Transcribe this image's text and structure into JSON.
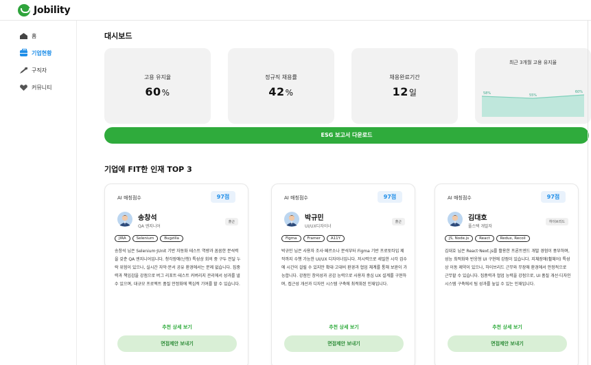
{
  "app": {
    "name": "Jobility",
    "brand_color": "#2fab3c",
    "accent_color": "#1f8ee8"
  },
  "sidebar": {
    "items": [
      {
        "label": "홈",
        "icon": "home-icon",
        "active": false
      },
      {
        "label": "기업현황",
        "icon": "briefcase-icon",
        "active": true
      },
      {
        "label": "구직자",
        "icon": "tool-icon",
        "active": false
      },
      {
        "label": "커뮤니티",
        "icon": "heart-icon",
        "active": false
      }
    ]
  },
  "dashboard": {
    "title": "대시보드",
    "stats": [
      {
        "label": "고용 유지율",
        "value": "60",
        "unit": "%"
      },
      {
        "label": "정규직 채용률",
        "value": "42",
        "unit": "%"
      },
      {
        "label": "채용완료기간",
        "value": "12",
        "unit": "일"
      }
    ],
    "chart_data": {
      "type": "area",
      "title": "최근 3개월 고용 유지율",
      "x": [
        "",
        "",
        ""
      ],
      "values": [
        58,
        55,
        60
      ],
      "data_labels": [
        "58%",
        "55%",
        "60%"
      ],
      "ylim": [
        0,
        100
      ],
      "fill_color": "#bfe7dc",
      "line_color": "#7fd0bb"
    },
    "esg_button": "ESG 보고서 다운로드"
  },
  "top3": {
    "title": "기업에 FIT한 인재 TOP 3",
    "ai_label": "AI 매칭점수",
    "detail_label": "추천 상세 보기",
    "offer_label": "면접제안 보내기",
    "candidates": [
      {
        "score": "97점",
        "name": "송창석",
        "role": "QA 엔지니어",
        "work_type": "출근",
        "tags": [
          "JIRA",
          "Selenium",
          "Bugzilla"
        ],
        "description": "송창석 님은 Selenium·JUnit 기반 자동화 테스트 역량과 꼼꼼한 분석력을 갖춘 QA 엔지니어입니다. 청각장애(난청) 특성상 회의 중 구두 전달 누락 위험이 있으나, 실시간 자막·문서 공유 환경에서는 문제 없습니다. 집중력과 책임감을 강점으로 버그 리포트·테스트 커버리지 관리에서 성과를 낼 수 있으며, 대규모 프로젝트 품질 안정화에 핵심적 기여를 할 수 있습니다."
      },
      {
        "score": "97점",
        "name": "박규민",
        "role": "UI/UX디자이너",
        "work_type": "출근",
        "tags": [
          "Figma",
          "Framer",
          "A11Y"
        ],
        "description": "박규민 님은 사용자 조사·페르소나 분석부터 Figma 기반 프로토타입 제작까지 수행 가능한 UI/UX 디자이너입니다. 저시력으로 세밀한 시각 검수에 시간이 걸릴 수 있지만 확대·고대비 환경과 협업 체계를 통해 보완이 가능합니다. 강점인 창의성과 공감 능력으로 사용자 중심 UX 설계를 구현하며, 접근성 개선과 디자인 시스템 구축에 최적화된 인재입니다."
      },
      {
        "score": "97점",
        "name": "김대호",
        "role": "풀스택 개발자",
        "work_type": "하이브리드",
        "tags": [
          "JS, Node.js",
          "React",
          "Redux, Recoil"
        ],
        "description": "김대호 님은 React·Next.js를 활용한 프론트엔드 개발 경험이 풍부하며, 성능 최적화와 반응형 UI 구현에 강점이 있습니다. 지체장애(휠체어) 특성상 이동 제약이 있으나, 하이브리드 근무와 무장애 환경에서 안정적으로 근무할 수 있습니다. 집중력과 협업 능력을 강점으로, UI 품질 개선·디자인 시스템 구축에서 팀 성과를 높일 수 있는 인재입니다."
      }
    ]
  }
}
